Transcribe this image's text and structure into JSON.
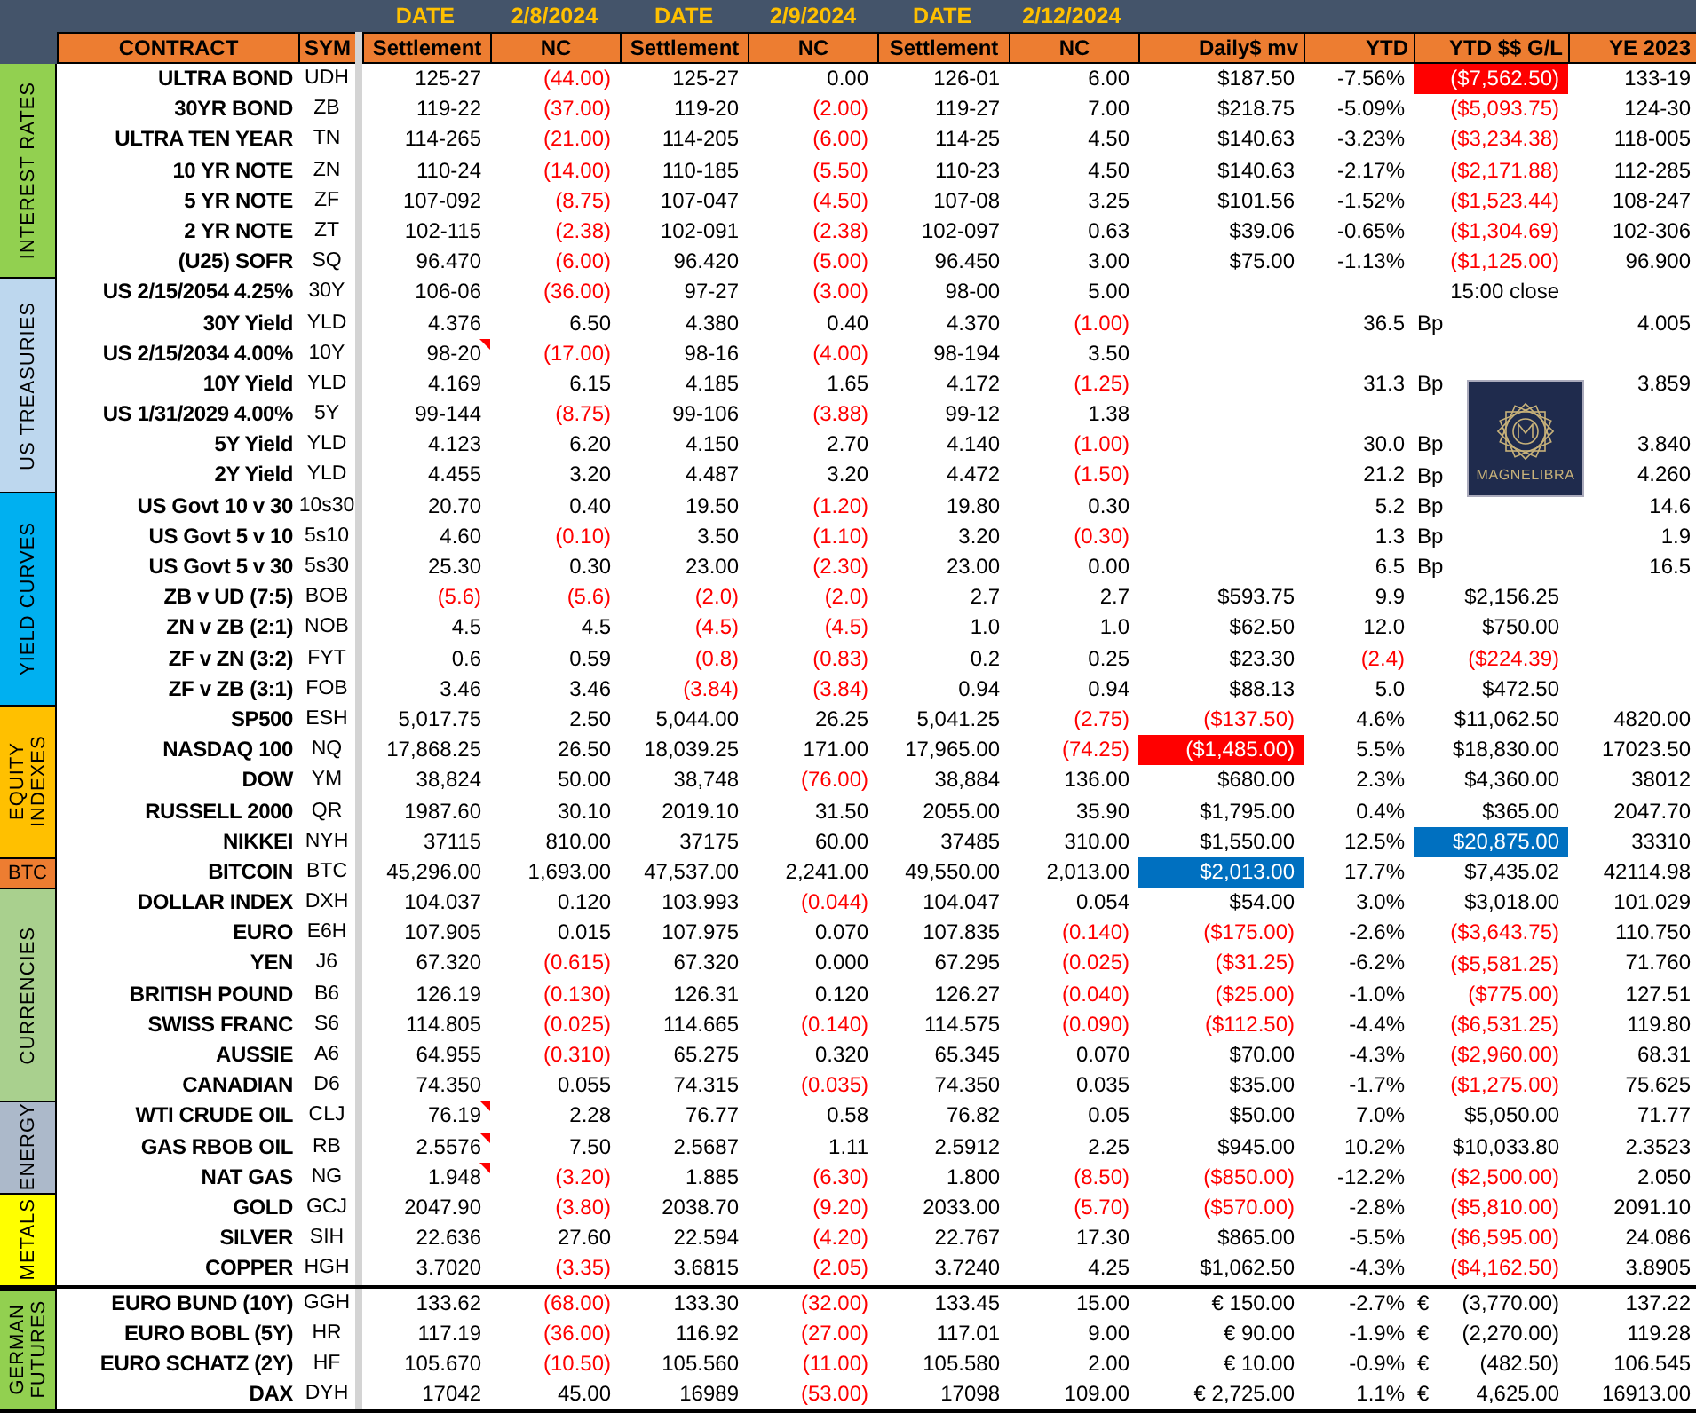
{
  "header": {
    "dates": [
      {
        "label": "DATE",
        "value": "2/8/2024"
      },
      {
        "label": "DATE",
        "value": "2/9/2024"
      },
      {
        "label": "DATE",
        "value": "2/12/2024"
      }
    ],
    "columns": [
      "CONTRACT",
      "SYM",
      "Settlement",
      "NC",
      "Settlement",
      "NC",
      "Settlement",
      "NC",
      "Daily$ mv",
      "YTD",
      "YTD $$ G/L",
      "YE 2023"
    ]
  },
  "logo": {
    "text": "MAGNELIBRA"
  },
  "sections": [
    {
      "label": "INTEREST RATES",
      "color": "#92d050",
      "rule_above": false,
      "rows": [
        {
          "name": "ULTRA BOND",
          "sym": "UDH",
          "s1": "125-27",
          "n1": "(44.00)",
          "s2": "125-27",
          "n2": "0.00",
          "s3": "126-01",
          "n3": "6.00",
          "daily": "$187.50",
          "ytd": "-7.56%",
          "gl": "($7,562.50)",
          "ye": "133-19",
          "red": [
            false,
            true,
            false,
            false,
            false,
            false,
            false,
            false,
            false
          ],
          "fill": {
            "gl": {
              "color": "#ff0000"
            }
          },
          "comment": false
        },
        {
          "name": "30YR BOND",
          "sym": "ZB",
          "s1": "119-22",
          "n1": "(37.00)",
          "s2": "119-20",
          "n2": "(2.00)",
          "s3": "119-27",
          "n3": "7.00",
          "daily": "$218.75",
          "ytd": "-5.09%",
          "gl": "($5,093.75)",
          "ye": "124-30",
          "red": [
            false,
            true,
            false,
            true,
            false,
            false,
            false,
            false,
            true
          ],
          "comment": false
        },
        {
          "name": "ULTRA TEN YEAR",
          "sym": "TN",
          "s1": "114-265",
          "n1": "(21.00)",
          "s2": "114-205",
          "n2": "(6.00)",
          "s3": "114-25",
          "n3": "4.50",
          "daily": "$140.63",
          "ytd": "-3.23%",
          "gl": "($3,234.38)",
          "ye": "118-005",
          "red": [
            false,
            true,
            false,
            true,
            false,
            false,
            false,
            false,
            true
          ],
          "comment": false
        },
        {
          "name": "10 YR NOTE",
          "sym": "ZN",
          "s1": "110-24",
          "n1": "(14.00)",
          "s2": "110-185",
          "n2": "(5.50)",
          "s3": "110-23",
          "n3": "4.50",
          "daily": "$140.63",
          "ytd": "-2.17%",
          "gl": "($2,171.88)",
          "ye": "112-285",
          "red": [
            false,
            true,
            false,
            true,
            false,
            false,
            false,
            false,
            true
          ],
          "comment": false
        },
        {
          "name": "5 YR NOTE",
          "sym": "ZF",
          "s1": "107-092",
          "n1": "(8.75)",
          "s2": "107-047",
          "n2": "(4.50)",
          "s3": "107-08",
          "n3": "3.25",
          "daily": "$101.56",
          "ytd": "-1.52%",
          "gl": "($1,523.44)",
          "ye": "108-247",
          "red": [
            false,
            true,
            false,
            true,
            false,
            false,
            false,
            false,
            true
          ],
          "comment": false
        },
        {
          "name": "2 YR NOTE",
          "sym": "ZT",
          "s1": "102-115",
          "n1": "(2.38)",
          "s2": "102-091",
          "n2": "(2.38)",
          "s3": "102-097",
          "n3": "0.63",
          "daily": "$39.06",
          "ytd": "-0.65%",
          "gl": "($1,304.69)",
          "ye": "102-306",
          "red": [
            false,
            true,
            false,
            true,
            false,
            false,
            false,
            false,
            true
          ],
          "comment": false
        },
        {
          "name": "(U25) SOFR",
          "sym": "SQ",
          "s1": "96.470",
          "n1": "(6.00)",
          "s2": "96.420",
          "n2": "(5.00)",
          "s3": "96.450",
          "n3": "3.00",
          "daily": "$75.00",
          "ytd": "-1.13%",
          "gl": "($1,125.00)",
          "ye": "96.900",
          "red": [
            false,
            true,
            false,
            true,
            false,
            false,
            false,
            false,
            true
          ],
          "comment": false
        }
      ]
    },
    {
      "label": "US TREASURIES",
      "color": "#bdd7ee",
      "rule_above": false,
      "rows": [
        {
          "name": "US 2/15/2054 4.25%",
          "sym": "30Y",
          "s1": "106-06",
          "n1": "(36.00)",
          "s2": "97-27",
          "n2": "(3.00)",
          "s3": "98-00",
          "n3": "5.00",
          "gl": "15:00 close",
          "red": [
            false,
            true,
            false,
            true,
            false,
            false,
            false,
            false,
            false
          ],
          "comment": false
        },
        {
          "name": "30Y Yield",
          "sym": "YLD",
          "s1": "4.376",
          "n1": "6.50",
          "s2": "4.380",
          "n2": "0.40",
          "s3": "4.370",
          "n3": "(1.00)",
          "ytd": "36.5",
          "unit": "Bp",
          "ye": "4.005",
          "red": [
            false,
            false,
            false,
            false,
            false,
            true,
            false,
            false,
            false
          ],
          "comment": false
        },
        {
          "name": "US 2/15/2034 4.00%",
          "sym": "10Y",
          "s1": "98-20",
          "n1": "(17.00)",
          "s2": "98-16",
          "n2": "(4.00)",
          "s3": "98-194",
          "n3": "3.50",
          "red": [
            false,
            true,
            false,
            true,
            false,
            false,
            false,
            false,
            false
          ],
          "comment": true
        },
        {
          "name": "10Y Yield",
          "sym": "YLD",
          "s1": "4.169",
          "n1": "6.15",
          "s2": "4.185",
          "n2": "1.65",
          "s3": "4.172",
          "n3": "(1.25)",
          "ytd": "31.3",
          "unit": "Bp",
          "ye": "3.859",
          "red": [
            false,
            false,
            false,
            false,
            false,
            true,
            false,
            false,
            false
          ],
          "comment": false
        },
        {
          "name": "US 1/31/2029 4.00%",
          "sym": "5Y",
          "s1": "99-144",
          "n1": "(8.75)",
          "s2": "99-106",
          "n2": "(3.88)",
          "s3": "99-12",
          "n3": "1.38",
          "red": [
            false,
            true,
            false,
            true,
            false,
            false,
            false,
            false,
            false
          ],
          "comment": false
        },
        {
          "name": "5Y Yield",
          "sym": "YLD",
          "s1": "4.123",
          "n1": "6.20",
          "s2": "4.150",
          "n2": "2.70",
          "s3": "4.140",
          "n3": "(1.00)",
          "ytd": "30.0",
          "unit": "Bp",
          "ye": "3.840",
          "red": [
            false,
            false,
            false,
            false,
            false,
            true,
            false,
            false,
            false
          ],
          "comment": false
        },
        {
          "name": "2Y Yield",
          "sym": "YLD",
          "s1": "4.455",
          "n1": "3.20",
          "s2": "4.487",
          "n2": "3.20",
          "s3": "4.472",
          "n3": "(1.50)",
          "ytd": "21.2",
          "unit": "Bp",
          "ye": "4.260",
          "red": [
            false,
            false,
            false,
            false,
            false,
            true,
            false,
            false,
            false
          ],
          "comment": false
        }
      ]
    },
    {
      "label": "YIELD CURVES",
      "color": "#00b0f0",
      "rule_above": false,
      "rows": [
        {
          "name": "US Govt 10 v 30",
          "sym": "10s30",
          "s1": "20.70",
          "n1": "0.40",
          "s2": "19.50",
          "n2": "(1.20)",
          "s3": "19.80",
          "n3": "0.30",
          "ytd": "5.2",
          "unit": "Bp",
          "ye": "14.6",
          "red": [
            false,
            false,
            false,
            true,
            false,
            false,
            false,
            false,
            false
          ],
          "comment": false
        },
        {
          "name": "US Govt 5 v 10",
          "sym": "5s10",
          "s1": "4.60",
          "n1": "(0.10)",
          "s2": "3.50",
          "n2": "(1.10)",
          "s3": "3.20",
          "n3": "(0.30)",
          "ytd": "1.3",
          "unit": "Bp",
          "ye": "1.9",
          "red": [
            false,
            true,
            false,
            true,
            false,
            true,
            false,
            false,
            false
          ],
          "comment": false
        },
        {
          "name": "US Govt 5 v 30",
          "sym": "5s30",
          "s1": "25.30",
          "n1": "0.30",
          "s2": "23.00",
          "n2": "(2.30)",
          "s3": "23.00",
          "n3": "0.00",
          "ytd": "6.5",
          "unit": "Bp",
          "ye": "16.5",
          "red": [
            false,
            false,
            false,
            true,
            false,
            false,
            false,
            false,
            false
          ],
          "comment": false
        },
        {
          "name": "ZB v UD (7:5)",
          "sym": "BOB",
          "s1": "(5.6)",
          "n1": "(5.6)",
          "s2": "(2.0)",
          "n2": "(2.0)",
          "s3": "2.7",
          "n3": "2.7",
          "daily": "$593.75",
          "ytd": "9.9",
          "gl": "$2,156.25",
          "red": [
            true,
            true,
            true,
            true,
            false,
            false,
            false,
            false,
            false
          ],
          "comment": false
        },
        {
          "name": "ZN v ZB (2:1)",
          "sym": "NOB",
          "s1": "4.5",
          "n1": "4.5",
          "s2": "(4.5)",
          "n2": "(4.5)",
          "s3": "1.0",
          "n3": "1.0",
          "daily": "$62.50",
          "ytd": "12.0",
          "gl": "$750.00",
          "red": [
            false,
            false,
            true,
            true,
            false,
            false,
            false,
            false,
            false
          ],
          "comment": false
        },
        {
          "name": "ZF v ZN (3:2)",
          "sym": "FYT",
          "s1": "0.6",
          "n1": "0.59",
          "s2": "(0.8)",
          "n2": "(0.83)",
          "s3": "0.2",
          "n3": "0.25",
          "daily": "$23.30",
          "ytd": "(2.4)",
          "gl": "($224.39)",
          "red": [
            false,
            false,
            true,
            true,
            false,
            false,
            false,
            true,
            true
          ],
          "comment": false
        },
        {
          "name": "ZF v ZB (3:1)",
          "sym": "FOB",
          "s1": "3.46",
          "n1": "3.46",
          "s2": "(3.84)",
          "n2": "(3.84)",
          "s3": "0.94",
          "n3": "0.94",
          "daily": "$88.13",
          "ytd": "5.0",
          "gl": "$472.50",
          "red": [
            false,
            false,
            true,
            true,
            false,
            false,
            false,
            false,
            false
          ],
          "comment": false
        }
      ]
    },
    {
      "label": "EQUITY INDEXES",
      "color": "#ffc000",
      "rule_above": false,
      "rows": [
        {
          "name": "SP500",
          "sym": "ESH",
          "s1": "5,017.75",
          "n1": "2.50",
          "s2": "5,044.00",
          "n2": "26.25",
          "s3": "5,041.25",
          "n3": "(2.75)",
          "daily": "($137.50)",
          "ytd": "4.6%",
          "gl": "$11,062.50",
          "ye": "4820.00",
          "red": [
            false,
            false,
            false,
            false,
            false,
            true,
            true,
            false,
            false
          ],
          "comment": false
        },
        {
          "name": "NASDAQ 100",
          "sym": "NQ",
          "s1": "17,868.25",
          "n1": "26.50",
          "s2": "18,039.25",
          "n2": "171.00",
          "s3": "17,965.00",
          "n3": "(74.25)",
          "daily": "($1,485.00)",
          "ytd": "5.5%",
          "gl": "$18,830.00",
          "ye": "17023.50",
          "red": [
            false,
            false,
            false,
            false,
            false,
            true,
            false,
            false,
            false
          ],
          "fill": {
            "daily": {
              "color": "#ff0000"
            }
          },
          "comment": false
        },
        {
          "name": "DOW",
          "sym": "YM",
          "s1": "38,824",
          "n1": "50.00",
          "s2": "38,748",
          "n2": "(76.00)",
          "s3": "38,884",
          "n3": "136.00",
          "daily": "$680.00",
          "ytd": "2.3%",
          "gl": "$4,360.00",
          "ye": "38012",
          "red": [
            false,
            false,
            false,
            true,
            false,
            false,
            false,
            false,
            false
          ],
          "comment": false
        },
        {
          "name": "RUSSELL 2000",
          "sym": "QR",
          "s1": "1987.60",
          "n1": "30.10",
          "s2": "2019.10",
          "n2": "31.50",
          "s3": "2055.00",
          "n3": "35.90",
          "daily": "$1,795.00",
          "ytd": "0.4%",
          "gl": "$365.00",
          "ye": "2047.70",
          "red": [
            false,
            false,
            false,
            false,
            false,
            false,
            false,
            false,
            false
          ],
          "comment": false
        },
        {
          "name": "NIKKEI",
          "sym": "NYH",
          "s1": "37115",
          "n1": "810.00",
          "s2": "37175",
          "n2": "60.00",
          "s3": "37485",
          "n3": "310.00",
          "daily": "$1,550.00",
          "ytd": "12.5%",
          "gl": "$20,875.00",
          "ye": "33310",
          "red": [
            false,
            false,
            false,
            false,
            false,
            false,
            false,
            false,
            false
          ],
          "fill": {
            "gl": {
              "color": "#0070c0"
            }
          },
          "comment": false
        }
      ]
    },
    {
      "label": "BTC",
      "color": "#ed7d31",
      "rule_above": false,
      "rows": [
        {
          "name": "BITCOIN",
          "sym": "BTC",
          "s1": "45,296.00",
          "n1": "1,693.00",
          "s2": "47,537.00",
          "n2": "2,241.00",
          "s3": "49,550.00",
          "n3": "2,013.00",
          "daily": "$2,013.00",
          "ytd": "17.7%",
          "gl": "$7,435.02",
          "ye": "42114.98",
          "red": [
            false,
            false,
            false,
            false,
            false,
            false,
            false,
            false,
            false
          ],
          "fill": {
            "daily": {
              "color": "#0070c0"
            }
          },
          "comment": false
        }
      ]
    },
    {
      "label": "CURRENCIES",
      "color": "#a9d08e",
      "rule_above": false,
      "rows": [
        {
          "name": "DOLLAR INDEX",
          "sym": "DXH",
          "s1": "104.037",
          "n1": "0.120",
          "s2": "103.993",
          "n2": "(0.044)",
          "s3": "104.047",
          "n3": "0.054",
          "daily": "$54.00",
          "ytd": "3.0%",
          "gl": "$3,018.00",
          "ye": "101.029",
          "red": [
            false,
            false,
            false,
            true,
            false,
            false,
            false,
            false,
            false
          ],
          "comment": false
        },
        {
          "name": "EURO",
          "sym": "E6H",
          "s1": "107.905",
          "n1": "0.015",
          "s2": "107.975",
          "n2": "0.070",
          "s3": "107.835",
          "n3": "(0.140)",
          "daily": "($175.00)",
          "ytd": "-2.6%",
          "gl": "($3,643.75)",
          "ye": "110.750",
          "red": [
            false,
            false,
            false,
            false,
            false,
            true,
            true,
            false,
            true
          ],
          "comment": false
        },
        {
          "name": "YEN",
          "sym": "J6",
          "s1": "67.320",
          "n1": "(0.615)",
          "s2": "67.320",
          "n2": "0.000",
          "s3": "67.295",
          "n3": "(0.025)",
          "daily": "($31.25)",
          "ytd": "-6.2%",
          "gl": "($5,581.25)",
          "ye": "71.760",
          "red": [
            false,
            true,
            false,
            false,
            false,
            true,
            true,
            false,
            true
          ],
          "comment": false
        },
        {
          "name": "BRITISH POUND",
          "sym": "B6",
          "s1": "126.19",
          "n1": "(0.130)",
          "s2": "126.31",
          "n2": "0.120",
          "s3": "126.27",
          "n3": "(0.040)",
          "daily": "($25.00)",
          "ytd": "-1.0%",
          "gl": "($775.00)",
          "ye": "127.51",
          "red": [
            false,
            true,
            false,
            false,
            false,
            true,
            true,
            false,
            true
          ],
          "comment": false
        },
        {
          "name": "SWISS FRANC",
          "sym": "S6",
          "s1": "114.805",
          "n1": "(0.025)",
          "s2": "114.665",
          "n2": "(0.140)",
          "s3": "114.575",
          "n3": "(0.090)",
          "daily": "($112.50)",
          "ytd": "-4.4%",
          "gl": "($6,531.25)",
          "ye": "119.80",
          "red": [
            false,
            true,
            false,
            true,
            false,
            true,
            true,
            false,
            true
          ],
          "comment": false
        },
        {
          "name": "AUSSIE",
          "sym": "A6",
          "s1": "64.955",
          "n1": "(0.310)",
          "s2": "65.275",
          "n2": "0.320",
          "s3": "65.345",
          "n3": "0.070",
          "daily": "$70.00",
          "ytd": "-4.3%",
          "gl": "($2,960.00)",
          "ye": "68.31",
          "red": [
            false,
            true,
            false,
            false,
            false,
            false,
            false,
            false,
            true
          ],
          "comment": false
        },
        {
          "name": "CANADIAN",
          "sym": "D6",
          "s1": "74.350",
          "n1": "0.055",
          "s2": "74.315",
          "n2": "(0.035)",
          "s3": "74.350",
          "n3": "0.035",
          "daily": "$35.00",
          "ytd": "-1.7%",
          "gl": "($1,275.00)",
          "ye": "75.625",
          "red": [
            false,
            false,
            false,
            true,
            false,
            false,
            false,
            false,
            true
          ],
          "comment": false
        }
      ]
    },
    {
      "label": "ENERGY",
      "color": "#acb9ca",
      "rule_above": false,
      "rows": [
        {
          "name": "WTI CRUDE OIL",
          "sym": "CLJ",
          "s1": "76.19",
          "n1": "2.28",
          "s2": "76.77",
          "n2": "0.58",
          "s3": "76.82",
          "n3": "0.05",
          "daily": "$50.00",
          "ytd": "7.0%",
          "gl": "$5,050.00",
          "ye": "71.77",
          "red": [
            false,
            false,
            false,
            false,
            false,
            false,
            false,
            false,
            false
          ],
          "comment": true
        },
        {
          "name": "GAS RBOB OIL",
          "sym": "RB",
          "s1": "2.5576",
          "n1": "7.50",
          "s2": "2.5687",
          "n2": "1.11",
          "s3": "2.5912",
          "n3": "2.25",
          "daily": "$945.00",
          "ytd": "10.2%",
          "gl": "$10,033.80",
          "ye": "2.3523",
          "red": [
            false,
            false,
            false,
            false,
            false,
            false,
            false,
            false,
            false
          ],
          "comment": true
        },
        {
          "name": "NAT GAS",
          "sym": "NG",
          "s1": "1.948",
          "n1": "(3.20)",
          "s2": "1.885",
          "n2": "(6.30)",
          "s3": "1.800",
          "n3": "(8.50)",
          "daily": "($850.00)",
          "ytd": "-12.2%",
          "gl": "($2,500.00)",
          "ye": "2.050",
          "red": [
            false,
            true,
            false,
            true,
            false,
            true,
            true,
            false,
            true
          ],
          "comment": true
        }
      ]
    },
    {
      "label": "METALS",
      "color": "#ffff00",
      "rule_above": false,
      "rows": [
        {
          "name": "GOLD",
          "sym": "GCJ",
          "s1": "2047.90",
          "n1": "(3.80)",
          "s2": "2038.70",
          "n2": "(9.20)",
          "s3": "2033.00",
          "n3": "(5.70)",
          "daily": "($570.00)",
          "ytd": "-2.8%",
          "gl": "($5,810.00)",
          "ye": "2091.10",
          "red": [
            false,
            true,
            false,
            true,
            false,
            true,
            true,
            false,
            true
          ],
          "comment": false
        },
        {
          "name": "SILVER",
          "sym": "SIH",
          "s1": "22.636",
          "n1": "27.60",
          "s2": "22.594",
          "n2": "(4.20)",
          "s3": "22.767",
          "n3": "17.30",
          "daily": "$865.00",
          "ytd": "-5.5%",
          "gl": "($6,595.00)",
          "ye": "24.086",
          "red": [
            false,
            false,
            false,
            true,
            false,
            false,
            false,
            false,
            true
          ],
          "comment": false
        },
        {
          "name": "COPPER",
          "sym": "HGH",
          "s1": "3.7020",
          "n1": "(3.35)",
          "s2": "3.6815",
          "n2": "(2.05)",
          "s3": "3.7240",
          "n3": "4.25",
          "daily": "$1,062.50",
          "ytd": "-4.3%",
          "gl": "($4,162.50)",
          "ye": "3.8905",
          "red": [
            false,
            true,
            false,
            true,
            false,
            false,
            false,
            false,
            true
          ],
          "comment": false
        }
      ]
    },
    {
      "label": "GERMAN FUTURES",
      "color": "#92d050",
      "rule_above": true,
      "rows": [
        {
          "name": "EURO BUND (10Y)",
          "sym": "GGH",
          "s1": "133.62",
          "n1": "(68.00)",
          "s2": "133.30",
          "n2": "(32.00)",
          "s3": "133.45",
          "n3": "15.00",
          "daily": "€ 150.00",
          "ytd": "-2.7%",
          "unit": "€",
          "gl": "(3,770.00)",
          "ye": "137.22",
          "red": [
            false,
            true,
            false,
            true,
            false,
            false,
            false,
            false,
            false
          ],
          "comment": false
        },
        {
          "name": "EURO BOBL (5Y)",
          "sym": "HR",
          "s1": "117.19",
          "n1": "(36.00)",
          "s2": "116.92",
          "n2": "(27.00)",
          "s3": "117.01",
          "n3": "9.00",
          "daily": "€ 90.00",
          "ytd": "-1.9%",
          "unit": "€",
          "gl": "(2,270.00)",
          "ye": "119.28",
          "red": [
            false,
            true,
            false,
            true,
            false,
            false,
            false,
            false,
            false
          ],
          "comment": false
        },
        {
          "name": "EURO SCHATZ (2Y)",
          "sym": "HF",
          "s1": "105.670",
          "n1": "(10.50)",
          "s2": "105.560",
          "n2": "(11.00)",
          "s3": "105.580",
          "n3": "2.00",
          "daily": "€ 10.00",
          "ytd": "-0.9%",
          "unit": "€",
          "gl": "(482.50)",
          "ye": "106.545",
          "red": [
            false,
            true,
            false,
            true,
            false,
            false,
            false,
            false,
            false
          ],
          "comment": false
        },
        {
          "name": "DAX",
          "sym": "DYH",
          "s1": "17042",
          "n1": "45.00",
          "s2": "16989",
          "n2": "(53.00)",
          "s3": "17098",
          "n3": "109.00",
          "daily": "€ 2,725.00",
          "ytd": "1.1%",
          "unit": "€",
          "gl": "4,625.00",
          "ye": "16913.00",
          "red": [
            false,
            false,
            false,
            true,
            false,
            false,
            false,
            false,
            false
          ],
          "comment": false
        }
      ]
    }
  ]
}
